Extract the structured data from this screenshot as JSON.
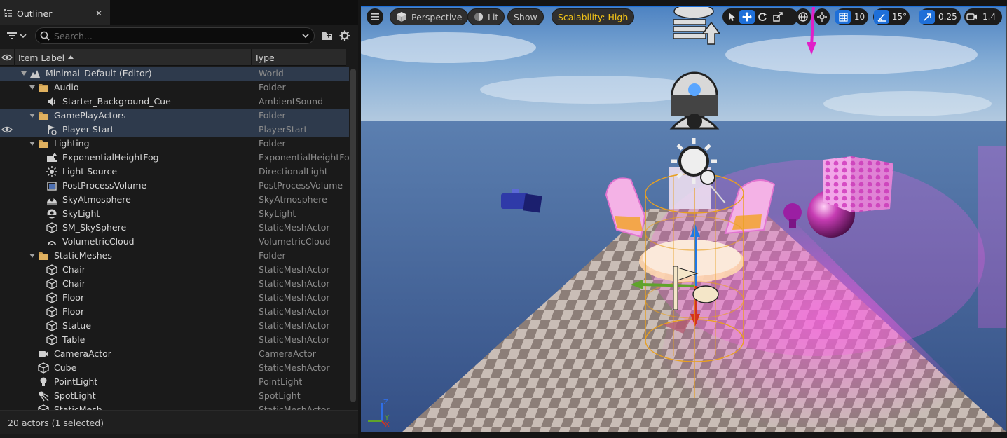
{
  "outliner": {
    "tab_label": "Outliner",
    "search_placeholder": "Search...",
    "columns": {
      "label": "Item Label",
      "type": "Type"
    },
    "rows": [
      {
        "label": "Minimal_Default (Editor)",
        "type": "World",
        "icon": "world-icon",
        "indent": 0,
        "expanded": true
      },
      {
        "label": "Audio",
        "type": "Folder",
        "icon": "folder-icon",
        "indent": 1,
        "expanded": true
      },
      {
        "label": "Starter_Background_Cue",
        "type": "AmbientSound",
        "icon": "speaker-icon",
        "indent": 2
      },
      {
        "label": "GamePlayActors",
        "type": "Folder",
        "icon": "folder-icon",
        "indent": 1,
        "expanded": true
      },
      {
        "label": "Player Start",
        "type": "PlayerStart",
        "icon": "player-start-icon",
        "indent": 2,
        "selected": true
      },
      {
        "label": "Lighting",
        "type": "Folder",
        "icon": "folder-icon",
        "indent": 1,
        "expanded": true
      },
      {
        "label": "ExponentialHeightFog",
        "type": "ExponentialHeightFog",
        "icon": "fog-icon",
        "indent": 2
      },
      {
        "label": "Light Source",
        "type": "DirectionalLight",
        "icon": "sun-icon",
        "indent": 2
      },
      {
        "label": "PostProcessVolume",
        "type": "PostProcessVolume",
        "icon": "volume-icon",
        "indent": 2
      },
      {
        "label": "SkyAtmosphere",
        "type": "SkyAtmosphere",
        "icon": "sky-atmosphere-icon",
        "indent": 2
      },
      {
        "label": "SkyLight",
        "type": "SkyLight",
        "icon": "skylight-icon",
        "indent": 2
      },
      {
        "label": "SM_SkySphere",
        "type": "StaticMeshActor",
        "icon": "cube-icon",
        "indent": 2
      },
      {
        "label": "VolumetricCloud",
        "type": "VolumetricCloud",
        "icon": "cloud-icon",
        "indent": 2
      },
      {
        "label": "StaticMeshes",
        "type": "Folder",
        "icon": "folder-icon",
        "indent": 1,
        "expanded": true
      },
      {
        "label": "Chair",
        "type": "StaticMeshActor",
        "icon": "cube-icon",
        "indent": 2
      },
      {
        "label": "Chair",
        "type": "StaticMeshActor",
        "icon": "cube-icon",
        "indent": 2
      },
      {
        "label": "Floor",
        "type": "StaticMeshActor",
        "icon": "cube-icon",
        "indent": 2
      },
      {
        "label": "Floor",
        "type": "StaticMeshActor",
        "icon": "cube-icon",
        "indent": 2
      },
      {
        "label": "Statue",
        "type": "StaticMeshActor",
        "icon": "cube-icon",
        "indent": 2
      },
      {
        "label": "Table",
        "type": "StaticMeshActor",
        "icon": "cube-icon",
        "indent": 2
      },
      {
        "label": "CameraActor",
        "type": "CameraActor",
        "icon": "camera-icon",
        "indent": 1
      },
      {
        "label": "Cube",
        "type": "StaticMeshActor",
        "icon": "cube-icon",
        "indent": 1
      },
      {
        "label": "PointLight",
        "type": "PointLight",
        "icon": "bulb-icon",
        "indent": 1
      },
      {
        "label": "SpotLight",
        "type": "SpotLight",
        "icon": "spotlight-icon",
        "indent": 1
      },
      {
        "label": "StaticMesh",
        "type": "StaticMeshActor",
        "icon": "cube-icon",
        "indent": 1
      }
    ],
    "status": "20 actors (1 selected)"
  },
  "viewport": {
    "perspective": "Perspective",
    "lit": "Lit",
    "show": "Show",
    "scalability": "Scalability: High",
    "grid_snap": "10",
    "rotation_snap": "15°",
    "scale_snap": "0.25",
    "camera_speed": "1.4",
    "axis_labels": {
      "z": "Z",
      "y": "Y",
      "x": "X"
    }
  },
  "colors": {
    "selection": "#2e3a4c",
    "accent_blue": "#1e6fd8",
    "scalability_text": "#f5c518",
    "sky": "#5d8fc4",
    "water": "#3f6197",
    "pink_light": "#ff4fd8",
    "wireframe": "#e8a020"
  }
}
